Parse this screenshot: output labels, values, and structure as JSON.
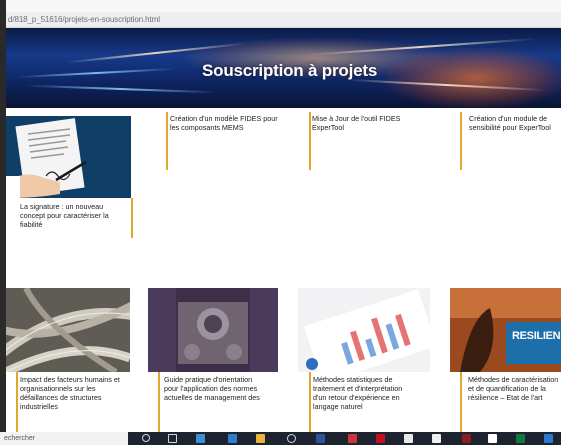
{
  "browser": {
    "url": "d/818_p_51616/projets-en-souscription.html"
  },
  "banner": {
    "title": "Souscription à projets"
  },
  "cards_row1": [
    {
      "title": "La signature : un nouveau concept pour caractériser la fiabilité"
    },
    {
      "title": "Création d'un modèle FIDES pour les composants MEMS"
    },
    {
      "title": "Mise à Jour de l'outil FIDES ExperTool"
    },
    {
      "title": "Création d'un module de sensibilité pour ExperTool"
    }
  ],
  "cards_row2": [
    {
      "title": "Impact des facteurs humains et organisationnels sur les défaillances de structures industrielles"
    },
    {
      "title": "Guide pratique d'orientation pour l'application des normes actuelles de management des"
    },
    {
      "title": "Méthodes statistiques de traitement et d'interprétation d'un retour d'expérience en langage naturel"
    },
    {
      "title": "Méthodes de caractérisation et de quantification de la résilience – Etat de l'art"
    }
  ],
  "image_labels": {
    "resilience": "RESILIEN"
  },
  "taskbar": {
    "search_placeholder": "echercher"
  },
  "colors": {
    "accent_bar": "#e2a62a",
    "banner_dark": "#0b1a45",
    "taskbar": "#1d2430"
  }
}
